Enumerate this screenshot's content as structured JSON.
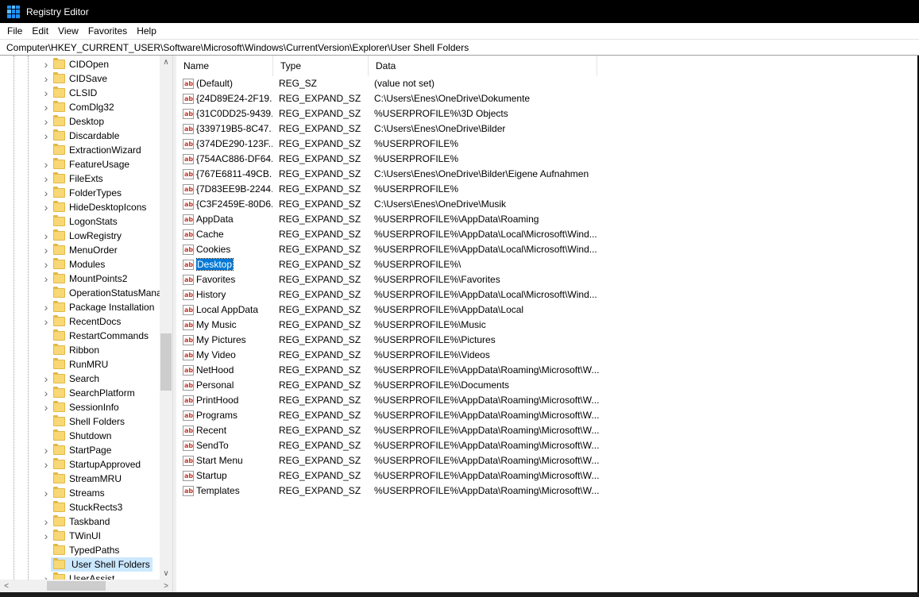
{
  "window": {
    "title": "Registry Editor"
  },
  "menu": [
    "File",
    "Edit",
    "View",
    "Favorites",
    "Help"
  ],
  "address": "Computer\\HKEY_CURRENT_USER\\Software\\Microsoft\\Windows\\CurrentVersion\\Explorer\\User Shell Folders",
  "tree": {
    "items": [
      {
        "label": "CIDOpen",
        "expandable": true
      },
      {
        "label": "CIDSave",
        "expandable": true
      },
      {
        "label": "CLSID",
        "expandable": true
      },
      {
        "label": "ComDlg32",
        "expandable": true
      },
      {
        "label": "Desktop",
        "expandable": true
      },
      {
        "label": "Discardable",
        "expandable": true
      },
      {
        "label": "ExtractionWizard",
        "expandable": false
      },
      {
        "label": "FeatureUsage",
        "expandable": true
      },
      {
        "label": "FileExts",
        "expandable": true
      },
      {
        "label": "FolderTypes",
        "expandable": true
      },
      {
        "label": "HideDesktopIcons",
        "expandable": true
      },
      {
        "label": "LogonStats",
        "expandable": false
      },
      {
        "label": "LowRegistry",
        "expandable": true
      },
      {
        "label": "MenuOrder",
        "expandable": true
      },
      {
        "label": "Modules",
        "expandable": true
      },
      {
        "label": "MountPoints2",
        "expandable": true
      },
      {
        "label": "OperationStatusMana",
        "expandable": false
      },
      {
        "label": "Package Installation",
        "expandable": true
      },
      {
        "label": "RecentDocs",
        "expandable": true
      },
      {
        "label": "RestartCommands",
        "expandable": false
      },
      {
        "label": "Ribbon",
        "expandable": false
      },
      {
        "label": "RunMRU",
        "expandable": false
      },
      {
        "label": "Search",
        "expandable": true
      },
      {
        "label": "SearchPlatform",
        "expandable": true
      },
      {
        "label": "SessionInfo",
        "expandable": true
      },
      {
        "label": "Shell Folders",
        "expandable": false
      },
      {
        "label": "Shutdown",
        "expandable": false
      },
      {
        "label": "StartPage",
        "expandable": true
      },
      {
        "label": "StartupApproved",
        "expandable": true
      },
      {
        "label": "StreamMRU",
        "expandable": false
      },
      {
        "label": "Streams",
        "expandable": true
      },
      {
        "label": "StuckRects3",
        "expandable": false
      },
      {
        "label": "Taskband",
        "expandable": true
      },
      {
        "label": "TWinUI",
        "expandable": true
      },
      {
        "label": "TypedPaths",
        "expandable": false
      },
      {
        "label": "User Shell Folders",
        "expandable": false,
        "selected": true
      },
      {
        "label": "UserAssist",
        "expandable": true
      }
    ]
  },
  "list": {
    "columns": [
      "Name",
      "Type",
      "Data"
    ],
    "rows": [
      {
        "name": "(Default)",
        "type": "REG_SZ",
        "data": "(value not set)"
      },
      {
        "name": "{24D89E24-2F19...",
        "type": "REG_EXPAND_SZ",
        "data": "C:\\Users\\Enes\\OneDrive\\Dokumente"
      },
      {
        "name": "{31C0DD25-9439...",
        "type": "REG_EXPAND_SZ",
        "data": "%USERPROFILE%\\3D Objects"
      },
      {
        "name": "{339719B5-8C47...",
        "type": "REG_EXPAND_SZ",
        "data": "C:\\Users\\Enes\\OneDrive\\Bilder"
      },
      {
        "name": "{374DE290-123F...",
        "type": "REG_EXPAND_SZ",
        "data": "%USERPROFILE%"
      },
      {
        "name": "{754AC886-DF64...",
        "type": "REG_EXPAND_SZ",
        "data": "%USERPROFILE%"
      },
      {
        "name": "{767E6811-49CB...",
        "type": "REG_EXPAND_SZ",
        "data": "C:\\Users\\Enes\\OneDrive\\Bilder\\Eigene Aufnahmen"
      },
      {
        "name": "{7D83EE9B-2244...",
        "type": "REG_EXPAND_SZ",
        "data": "%USERPROFILE%"
      },
      {
        "name": "{C3F2459E-80D6...",
        "type": "REG_EXPAND_SZ",
        "data": "C:\\Users\\Enes\\OneDrive\\Musik"
      },
      {
        "name": "AppData",
        "type": "REG_EXPAND_SZ",
        "data": "%USERPROFILE%\\AppData\\Roaming"
      },
      {
        "name": "Cache",
        "type": "REG_EXPAND_SZ",
        "data": "%USERPROFILE%\\AppData\\Local\\Microsoft\\Wind..."
      },
      {
        "name": "Cookies",
        "type": "REG_EXPAND_SZ",
        "data": "%USERPROFILE%\\AppData\\Local\\Microsoft\\Wind..."
      },
      {
        "name": "Desktop",
        "type": "REG_EXPAND_SZ",
        "data": "%USERPROFILE%\\",
        "selected": true
      },
      {
        "name": "Favorites",
        "type": "REG_EXPAND_SZ",
        "data": "%USERPROFILE%\\Favorites"
      },
      {
        "name": "History",
        "type": "REG_EXPAND_SZ",
        "data": "%USERPROFILE%\\AppData\\Local\\Microsoft\\Wind..."
      },
      {
        "name": "Local AppData",
        "type": "REG_EXPAND_SZ",
        "data": "%USERPROFILE%\\AppData\\Local"
      },
      {
        "name": "My Music",
        "type": "REG_EXPAND_SZ",
        "data": "%USERPROFILE%\\Music"
      },
      {
        "name": "My Pictures",
        "type": "REG_EXPAND_SZ",
        "data": "%USERPROFILE%\\Pictures"
      },
      {
        "name": "My Video",
        "type": "REG_EXPAND_SZ",
        "data": "%USERPROFILE%\\Videos"
      },
      {
        "name": "NetHood",
        "type": "REG_EXPAND_SZ",
        "data": "%USERPROFILE%\\AppData\\Roaming\\Microsoft\\W..."
      },
      {
        "name": "Personal",
        "type": "REG_EXPAND_SZ",
        "data": "%USERPROFILE%\\Documents"
      },
      {
        "name": "PrintHood",
        "type": "REG_EXPAND_SZ",
        "data": "%USERPROFILE%\\AppData\\Roaming\\Microsoft\\W..."
      },
      {
        "name": "Programs",
        "type": "REG_EXPAND_SZ",
        "data": "%USERPROFILE%\\AppData\\Roaming\\Microsoft\\W..."
      },
      {
        "name": "Recent",
        "type": "REG_EXPAND_SZ",
        "data": "%USERPROFILE%\\AppData\\Roaming\\Microsoft\\W..."
      },
      {
        "name": "SendTo",
        "type": "REG_EXPAND_SZ",
        "data": "%USERPROFILE%\\AppData\\Roaming\\Microsoft\\W..."
      },
      {
        "name": "Start Menu",
        "type": "REG_EXPAND_SZ",
        "data": "%USERPROFILE%\\AppData\\Roaming\\Microsoft\\W..."
      },
      {
        "name": "Startup",
        "type": "REG_EXPAND_SZ",
        "data": "%USERPROFILE%\\AppData\\Roaming\\Microsoft\\W..."
      },
      {
        "name": "Templates",
        "type": "REG_EXPAND_SZ",
        "data": "%USERPROFILE%\\AppData\\Roaming\\Microsoft\\W..."
      }
    ]
  },
  "icons": {
    "app": "registry-editor-icon",
    "folder": "folder-icon",
    "value": "string-value-icon",
    "expand": "chevron-right-icon"
  },
  "colors": {
    "titlebar": "#000000",
    "selection": "#0078d7",
    "tree_selection": "#cce8ff",
    "folder": "#f8d775"
  }
}
